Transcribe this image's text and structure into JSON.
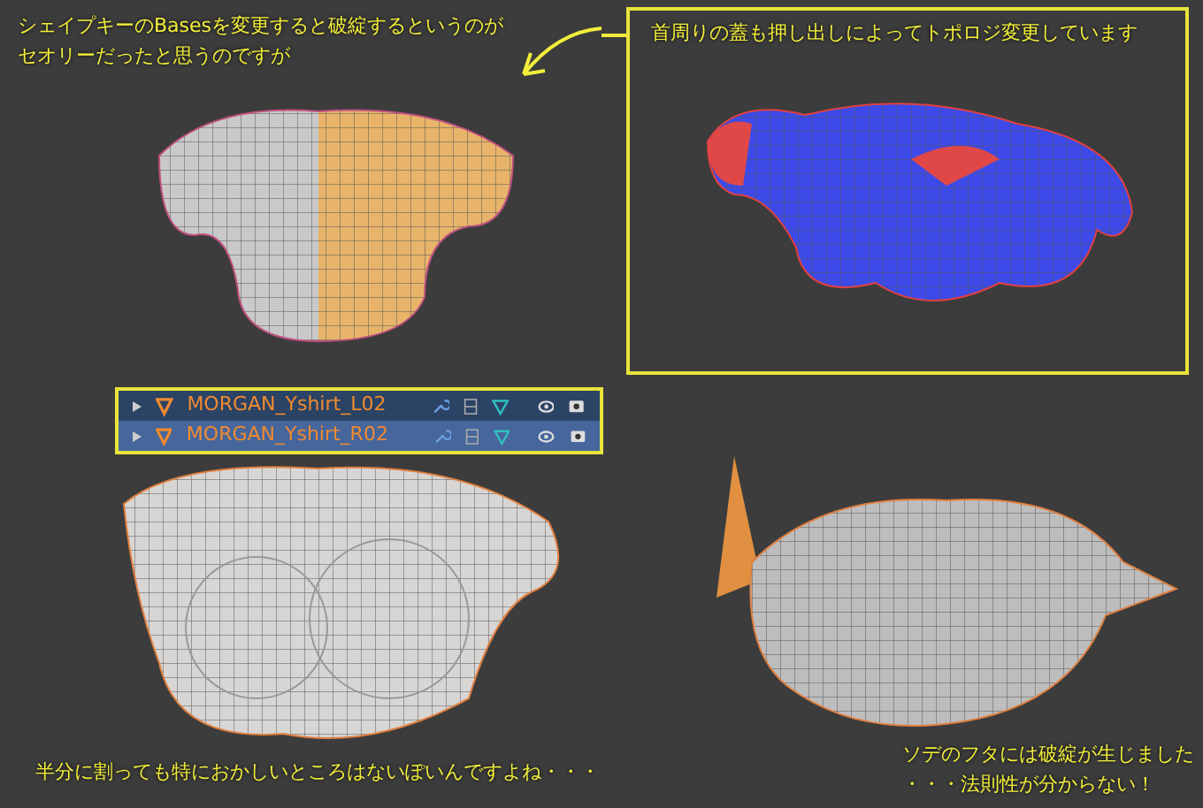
{
  "notes": [
    {
      "kind": "plain",
      "lines": [
        "シェイプキーのBasesを変更すると破綻するというのが",
        "セオリーだったと思うのですが"
      ]
    },
    {
      "kind": "boxed",
      "lines": [
        "首周りの蓋も押し出しによってトポロジ変更しています"
      ]
    },
    {
      "kind": "plain",
      "lines": [
        "半分に割っても特におかしいところはないぽいんですよね・・・"
      ]
    },
    {
      "kind": "plain",
      "lines": [
        "ソデのフタには破綻が生じました",
        "・・・法則性が分からない！"
      ]
    }
  ],
  "outliner": {
    "rows": [
      {
        "name": "MORGAN_Yshirt_L02",
        "selected": false
      },
      {
        "name": "MORGAN_Yshirt_R02",
        "selected": true
      }
    ]
  }
}
